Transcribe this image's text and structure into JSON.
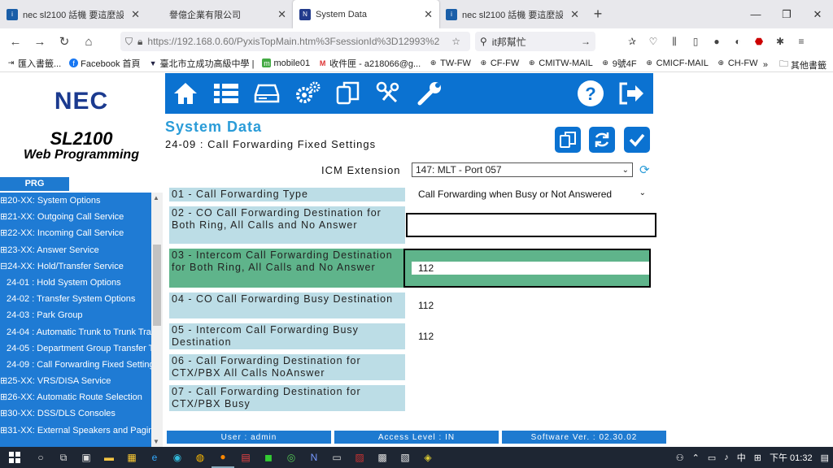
{
  "browser": {
    "tabs": [
      {
        "title": "nec sl2100 話機 要這麼設定轉",
        "active": false
      },
      {
        "title": "譽億企業有限公司",
        "active": false
      },
      {
        "title": "System Data",
        "active": true
      },
      {
        "title": "nec sl2100 話機 要這麼設定轉",
        "active": false
      }
    ],
    "url": "https://192.168.0.60/PyxisTopMain.htm%3FsessionId%3D12993%2",
    "search_text": "it邦幫忙",
    "bookmarks": [
      "匯入書籤...",
      "Facebook 首頁",
      "臺北市立成功高級中學 |",
      "mobile01",
      "收件匣 - a218066@g...",
      "TW-FW",
      "CF-FW",
      "CMITW-MAIL",
      "9號4F",
      "CMICF-MAIL",
      "CH-FW"
    ],
    "other_bookmarks": "其他書籤"
  },
  "sidebar": {
    "brand": "NEC",
    "product": "SL2100",
    "product_sub": "Web Programming",
    "prg_label": "PRG",
    "items": [
      {
        "label": "⊞20-XX: System Options",
        "sub": false
      },
      {
        "label": "⊞21-XX: Outgoing Call Service",
        "sub": false
      },
      {
        "label": "⊞22-XX: Incoming Call Service",
        "sub": false
      },
      {
        "label": "⊞23-XX: Answer Service",
        "sub": false
      },
      {
        "label": "⊟24-XX: Hold/Transfer Service",
        "sub": false
      },
      {
        "label": "24-01 : Hold System Options",
        "sub": true
      },
      {
        "label": "24-02 : Transfer System Options",
        "sub": true
      },
      {
        "label": "24-03 : Park Group",
        "sub": true
      },
      {
        "label": "24-04 : Automatic Trunk to Trunk Tra",
        "sub": true
      },
      {
        "label": "24-05 : Department Group Transfer T",
        "sub": true
      },
      {
        "label": "24-09 : Call Forwarding Fixed Setting",
        "sub": true
      },
      {
        "label": "⊞25-XX: VRS/DISA Service",
        "sub": false
      },
      {
        "label": "⊞26-XX: Automatic Route Selection",
        "sub": false
      },
      {
        "label": "⊞30-XX: DSS/DLS Consoles",
        "sub": false
      },
      {
        "label": "⊞31-XX: External Speakers and Pagin",
        "sub": false
      }
    ]
  },
  "page": {
    "title": "System Data",
    "subtitle": "24-09 : Call Forwarding Fixed Settings",
    "icm_label": "ICM Extension",
    "icm_value": "147: MLT - Port 057",
    "rows": [
      {
        "label": "01 - Call Forwarding Type",
        "value": "Call Forwarding when Busy or Not Answered",
        "type": "select"
      },
      {
        "label": "02 - CO Call Forwarding Destination for Both Ring, All Calls and No Answer",
        "value": "",
        "type": "input"
      },
      {
        "label": "03 - Intercom Call Forwarding Destination for Both Ring, All Calls and No Answer",
        "value": "112",
        "type": "input"
      },
      {
        "label": "04 - CO Call Forwarding Busy Destination",
        "value": "112",
        "type": "input"
      },
      {
        "label": "05 - Intercom Call Forwarding Busy Destination",
        "value": "112",
        "type": "input"
      },
      {
        "label": "06 - Call Forwarding Destination for CTX/PBX All Calls NoAnswer",
        "value": "",
        "type": "input"
      },
      {
        "label": "07 - Call Forwarding Destination for CTX/PBX Busy",
        "value": "",
        "type": "input"
      }
    ]
  },
  "status": {
    "user": "User : admin",
    "access": "Access Level : IN",
    "version": "Software Ver. : 02.30.02"
  },
  "taskbar": {
    "time": "下午 01:32",
    "ime": "中"
  },
  "colors": {
    "toolbar_blue": "#0b72d1",
    "nav_blue": "#1f7bd4",
    "title_blue": "#2a9cd8",
    "label_bg": "#bcdde6",
    "highlight_green": "#5fb48b"
  }
}
